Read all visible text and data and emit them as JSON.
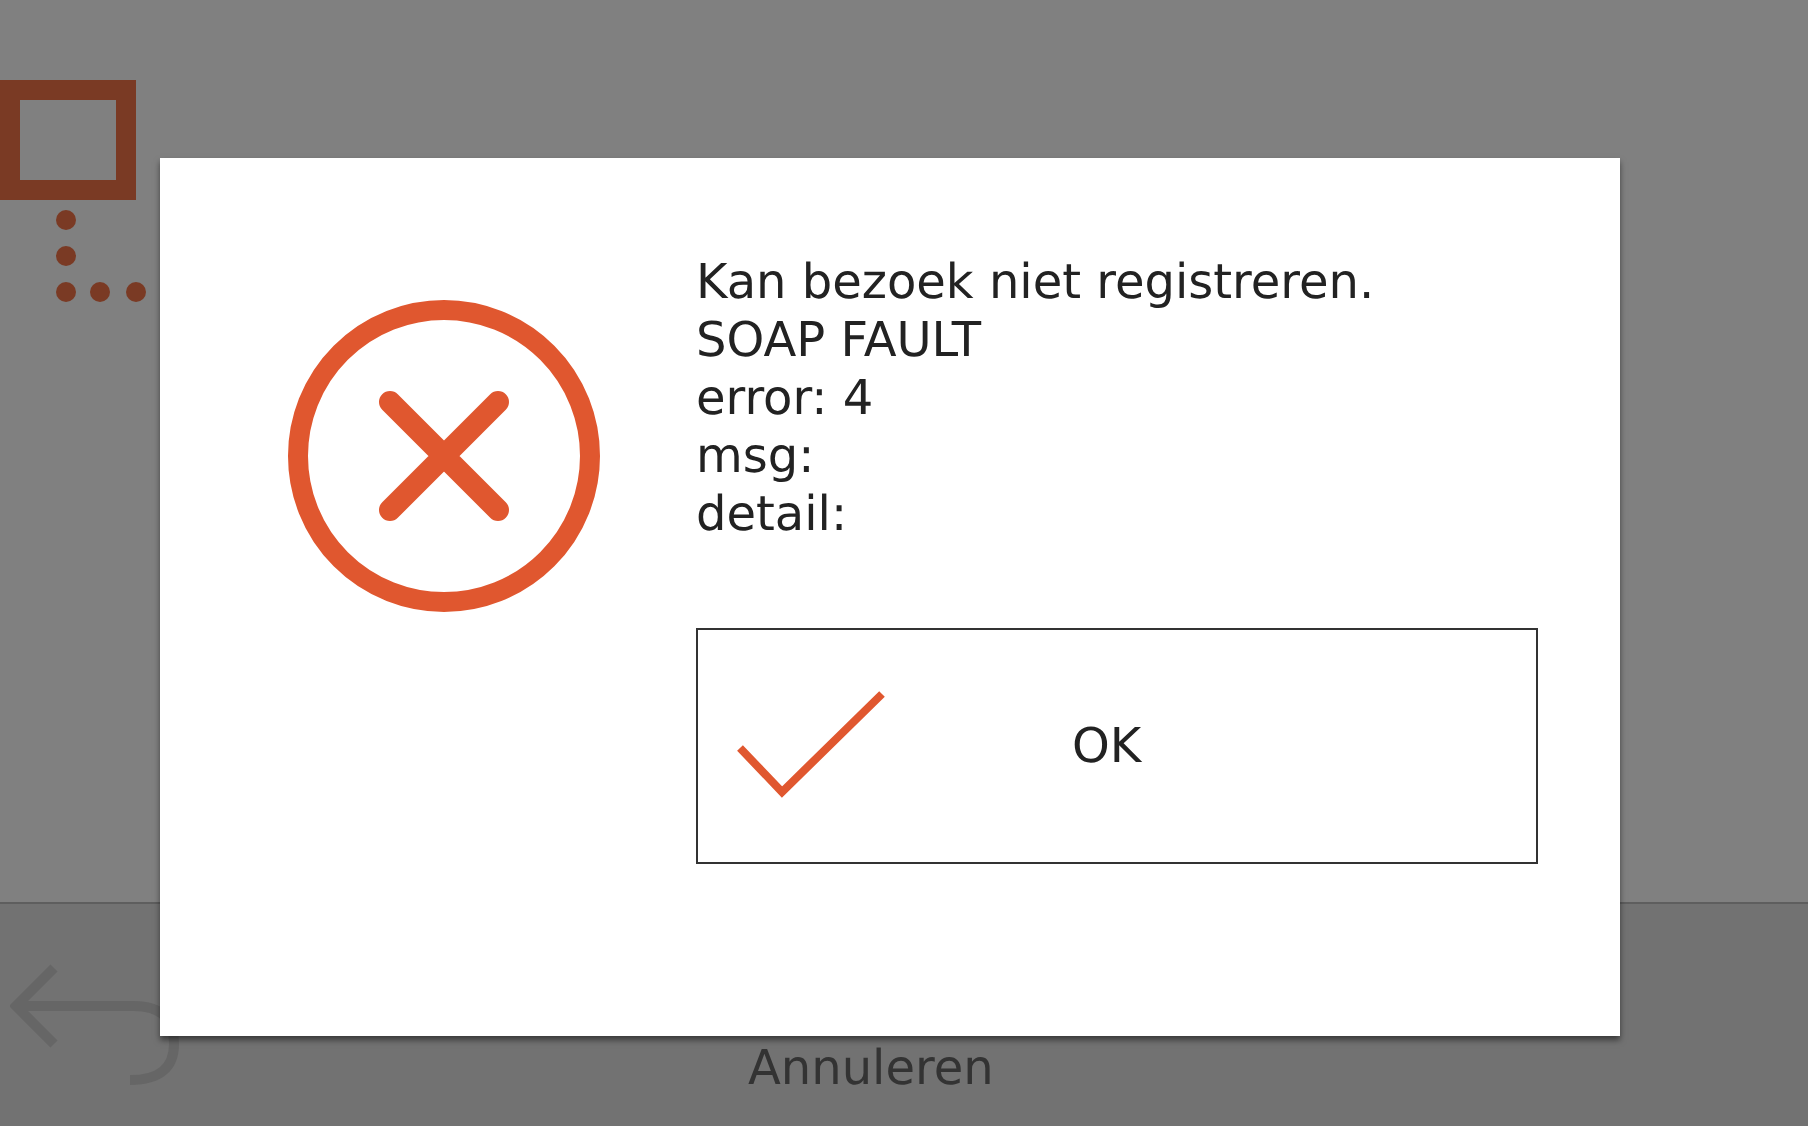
{
  "background_screen": {
    "cancel_label": "Annuleren"
  },
  "dialog": {
    "kind": "error",
    "message_lines": [
      "Kan bezoek niet registreren.",
      "SOAP FAULT",
      "error: 4",
      "msg:",
      "detail:"
    ],
    "ok_button": "OK"
  }
}
